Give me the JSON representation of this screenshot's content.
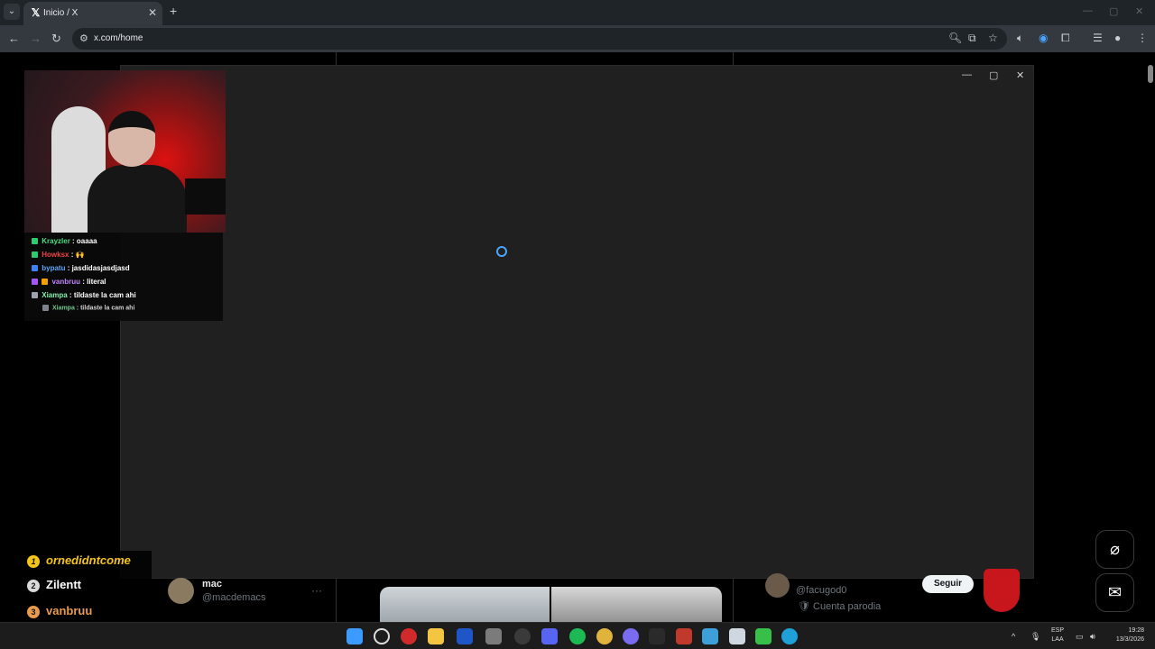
{
  "browser": {
    "tab_title": "Inicio / X",
    "tab_favicon": "𝕏",
    "url": "x.com/home"
  },
  "chat": {
    "messages": [
      {
        "user": "Krayzler",
        "text": "oaaaa",
        "color": "#4ade80"
      },
      {
        "user": "Howksx",
        "text": "🙌",
        "color": "#ef4444"
      },
      {
        "user": "bypatu",
        "text": "jasdidasjasdjasd",
        "color": "#60a5fa"
      },
      {
        "user": "vanbruu",
        "text": "literal",
        "color": "#c084fc"
      },
      {
        "user": "Xiampa",
        "text": "tildaste la cam ahi",
        "color": "#86efac"
      },
      {
        "user": "Xiampa",
        "text": "tildaste la cam ahi",
        "color": "#86efac"
      }
    ]
  },
  "leaderboard": [
    {
      "rank": "1",
      "name": "ornedidntcome",
      "color": "#f5c518"
    },
    {
      "rank": "2",
      "name": "Zilentt",
      "color": "#d9d9d9"
    },
    {
      "rank": "3",
      "name": "vanbruu",
      "color": "#e89b4c"
    }
  ],
  "post": {
    "name": "mac",
    "handle": "@macdemacs"
  },
  "suggestion": {
    "handle": "@facugod0",
    "parody_label": "Cuenta parodia",
    "follow_label": "Seguir"
  },
  "tray": {
    "lang_line1": "ESP",
    "lang_line2": "LAA",
    "time": "19:28",
    "date": "13/3/2026"
  },
  "colors": {
    "accent": "#1d9bf0",
    "modal_bg": "#202020"
  }
}
